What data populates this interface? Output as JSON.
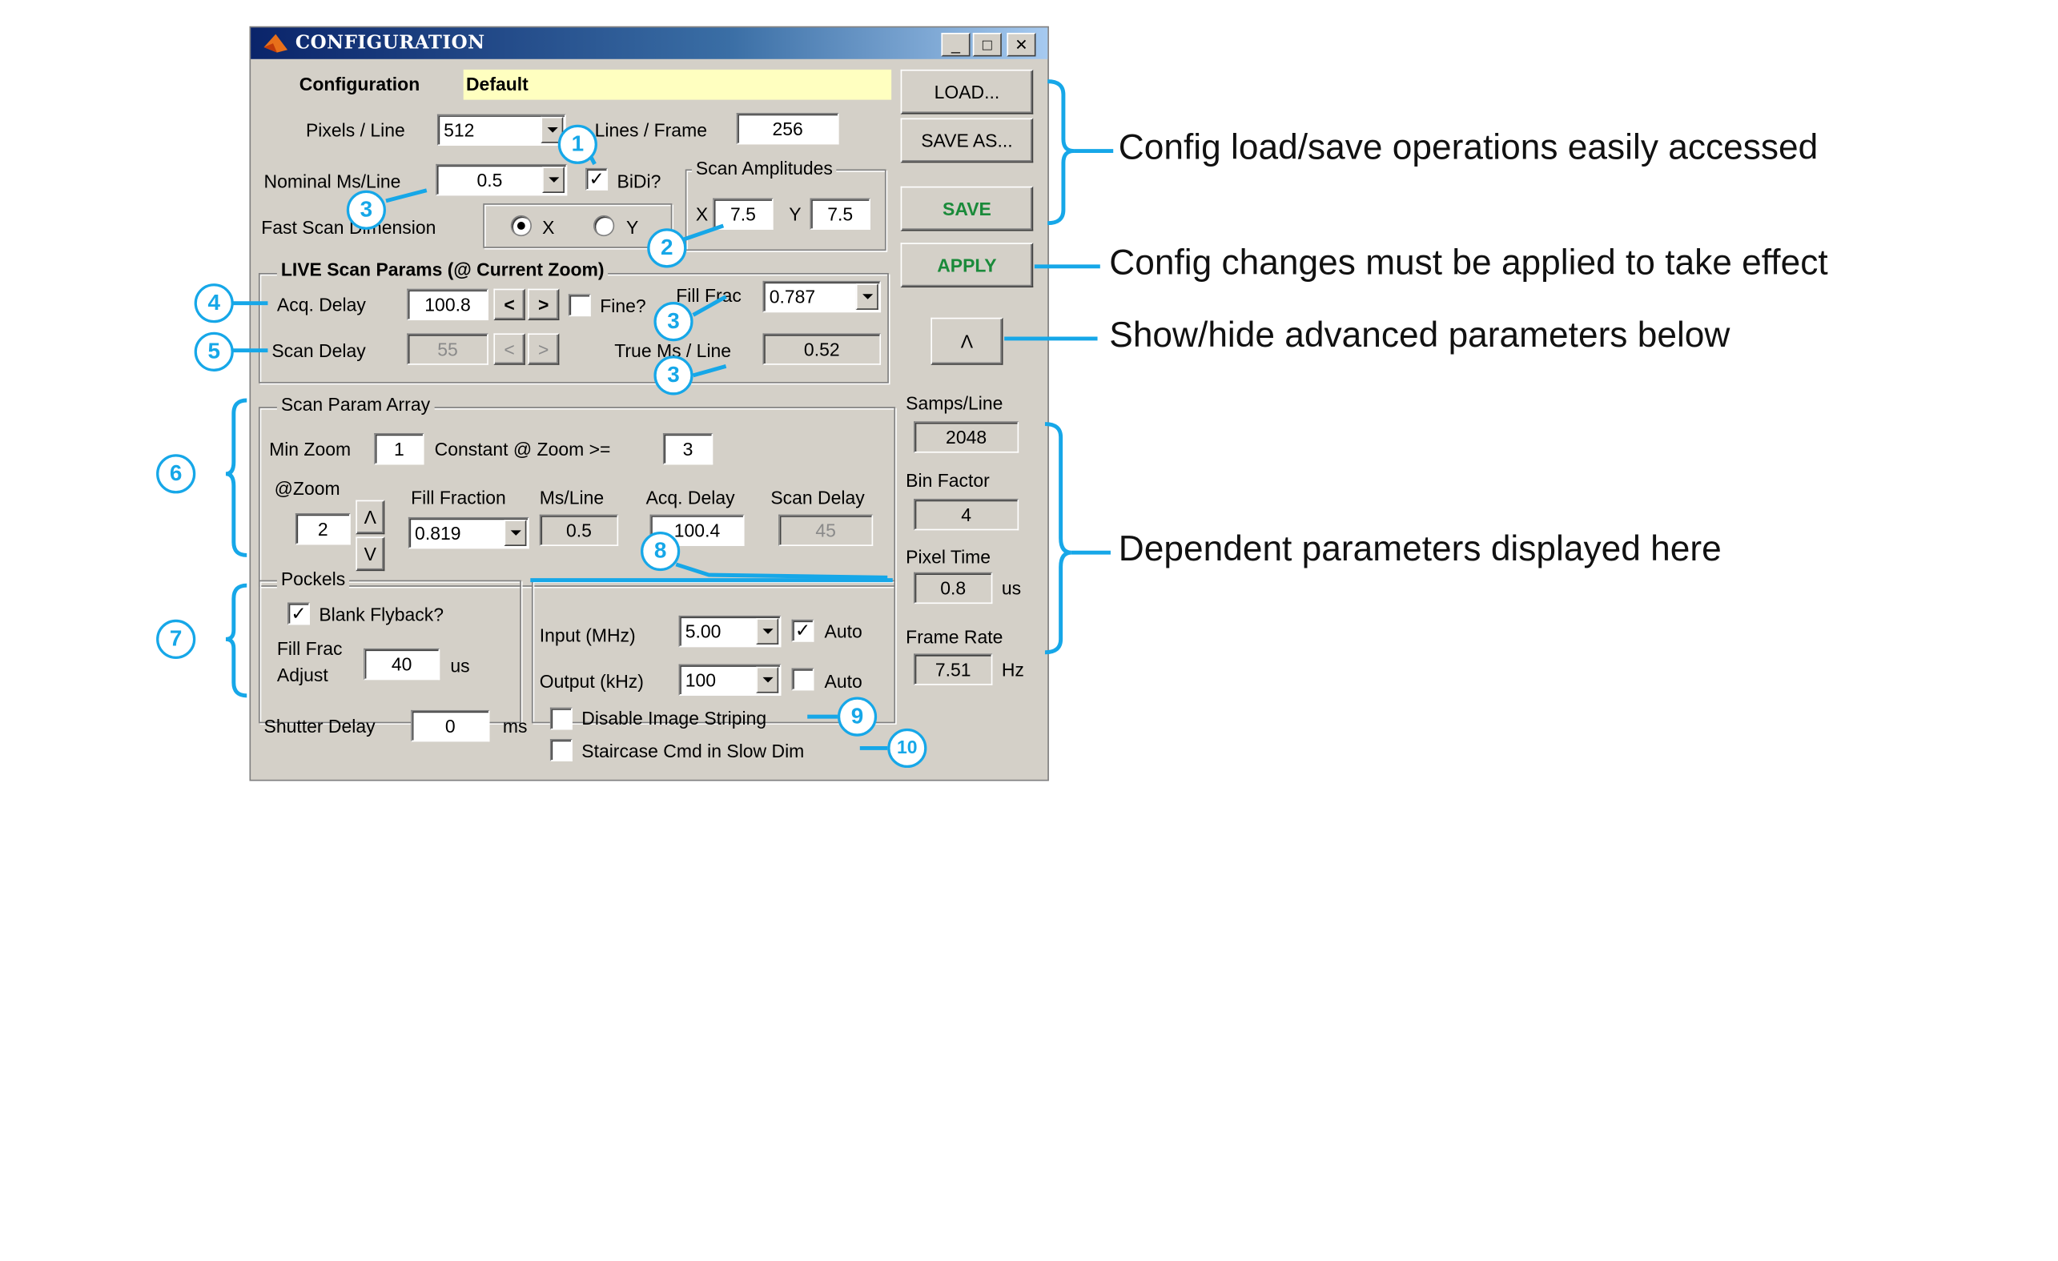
{
  "window": {
    "title": "CONFIGURATION",
    "minimize": "_",
    "maximize": "□",
    "close": "✕"
  },
  "config": {
    "label": "Configuration",
    "value": "Default",
    "pixels_per_line_label": "Pixels / Line",
    "pixels_per_line": "512",
    "lines_per_frame_label": "Lines / Frame",
    "lines_per_frame": "256",
    "nominal_ms_line_label": "Nominal Ms/Line",
    "nominal_ms_line": "0.5",
    "bidi_label": "BiDi?",
    "bidi_check": "✓",
    "fast_scan_label": "Fast Scan Dimension",
    "radio_x": "X",
    "radio_y": "Y",
    "scan_amp_title": "Scan Amplitudes",
    "amp_x_label": "X",
    "amp_x": "7.5",
    "amp_y_label": "Y",
    "amp_y": "7.5"
  },
  "buttons": {
    "load": "LOAD...",
    "save_as": "SAVE AS...",
    "save": "SAVE",
    "apply": "APPLY",
    "toggle": "Λ"
  },
  "live": {
    "title": "LIVE Scan Params (@ Current Zoom)",
    "acq_delay_label": "Acq. Delay",
    "acq_delay": "100.8",
    "dec": "<",
    "inc": ">",
    "fine_label": "Fine?",
    "fill_frac_label": "Fill Frac",
    "fill_frac": "0.787",
    "scan_delay_label": "Scan Delay",
    "scan_delay": "55",
    "true_ms_label": "True Ms / Line",
    "true_ms": "0.52"
  },
  "array": {
    "title": "Scan Param Array",
    "min_zoom_label": "Min Zoom",
    "min_zoom": "1",
    "constant_label": "Constant @  Zoom >=",
    "constant_zoom": "3",
    "at_zoom_label": "@Zoom",
    "at_zoom": "2",
    "up": "Λ",
    "down": "V",
    "fill_fraction_label": "Fill Fraction",
    "fill_fraction": "0.819",
    "ms_line_label": "Ms/Line",
    "ms_line": "0.5",
    "acq_delay_label": "Acq. Delay",
    "acq_delay": "100.4",
    "scan_delay_label": "Scan Delay",
    "scan_delay": "45"
  },
  "pockels": {
    "title": "Pockels",
    "blank_label": "Blank Flyback?",
    "blank_check": "✓",
    "fill_frac_label_1": "Fill Frac",
    "fill_frac_label_2": "Adjust",
    "fill_frac_adjust": "40",
    "unit": "us"
  },
  "rates": {
    "input_label": "Input (MHz)",
    "input": "5.00",
    "input_auto_check": "✓",
    "output_label": "Output (kHz)",
    "output": "100",
    "auto_label": "Auto"
  },
  "side": {
    "samps_label": "Samps/Line",
    "samps": "2048",
    "bin_label": "Bin Factor",
    "bin": "4",
    "pixel_time_label": "Pixel Time",
    "pixel_time": "0.8",
    "pixel_time_unit": "us",
    "frame_rate_label": "Frame Rate",
    "frame_rate": "7.51",
    "frame_rate_unit": "Hz"
  },
  "bottom": {
    "shutter_label": "Shutter Delay",
    "shutter": "0",
    "shutter_unit": "ms",
    "disable_striping": "Disable Image Striping",
    "staircase": "Staircase Cmd in Slow Dim"
  },
  "annotations": {
    "config_ops": "Config load/save operations easily accessed",
    "apply_note": "Config changes must be applied to take effect",
    "advanced_note": "Show/hide advanced parameters below",
    "dependent_note": "Dependent parameters displayed here",
    "n1": "1",
    "n2": "2",
    "n3": "3",
    "n4": "4",
    "n5": "5",
    "n6": "6",
    "n7": "7",
    "n8": "8",
    "n9": "9",
    "n10": "10"
  },
  "colors": {
    "callout": "#16a7e8",
    "title_bar": "#0a246a",
    "highlight": "#ffffc0",
    "green_button_text": "#1a8a3a"
  }
}
